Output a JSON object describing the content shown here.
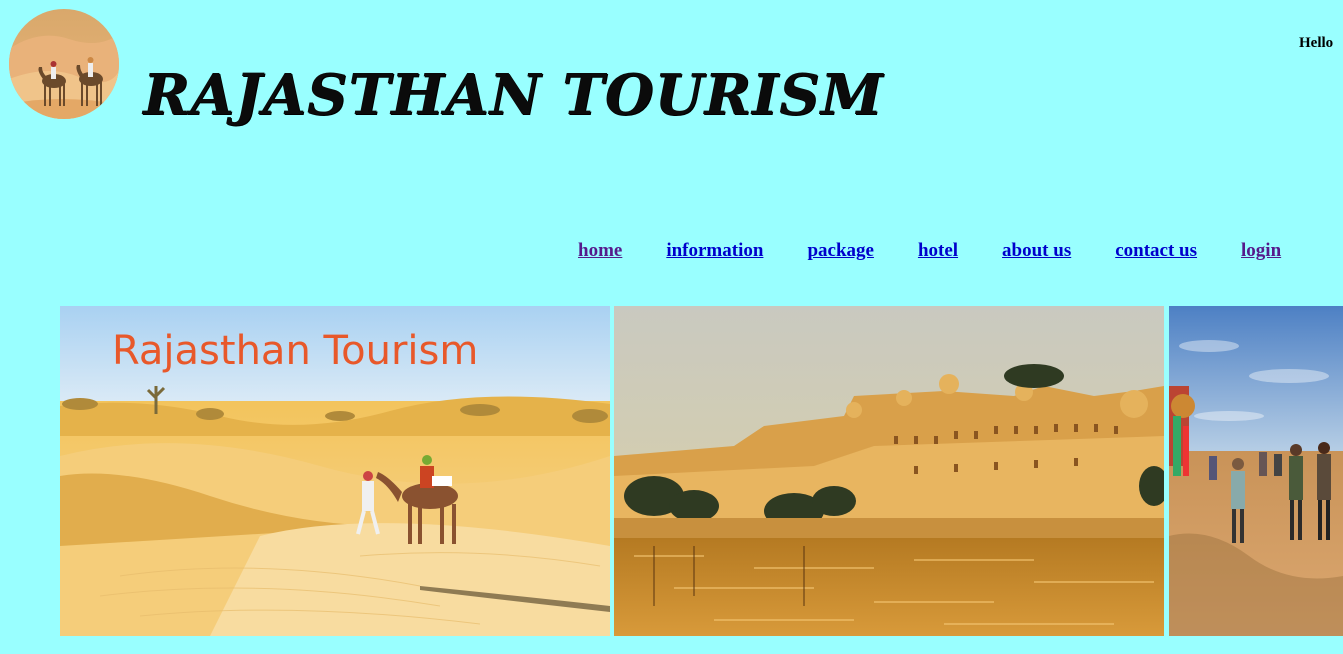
{
  "header": {
    "title": "RAJASTHAN TOURISM",
    "greeting": "Hello",
    "logo_icon": "camel-desert-logo-icon"
  },
  "nav": {
    "items": [
      {
        "label": "home",
        "visited": true
      },
      {
        "label": "information",
        "visited": false
      },
      {
        "label": "package",
        "visited": false
      },
      {
        "label": "hotel",
        "visited": false
      },
      {
        "label": "about us",
        "visited": false
      },
      {
        "label": "contact us",
        "visited": false
      },
      {
        "label": "login",
        "visited": true
      }
    ]
  },
  "banner": {
    "slides": [
      {
        "caption": "Rajasthan Tourism",
        "subject": "desert-camel"
      },
      {
        "caption": "",
        "subject": "lake-palace"
      },
      {
        "caption": "",
        "subject": "camel-fair-crowd"
      }
    ]
  },
  "colors": {
    "background": "#99ffff",
    "link": "#0000cc",
    "link_visited": "#551a8b",
    "caption": "#e8582a"
  }
}
